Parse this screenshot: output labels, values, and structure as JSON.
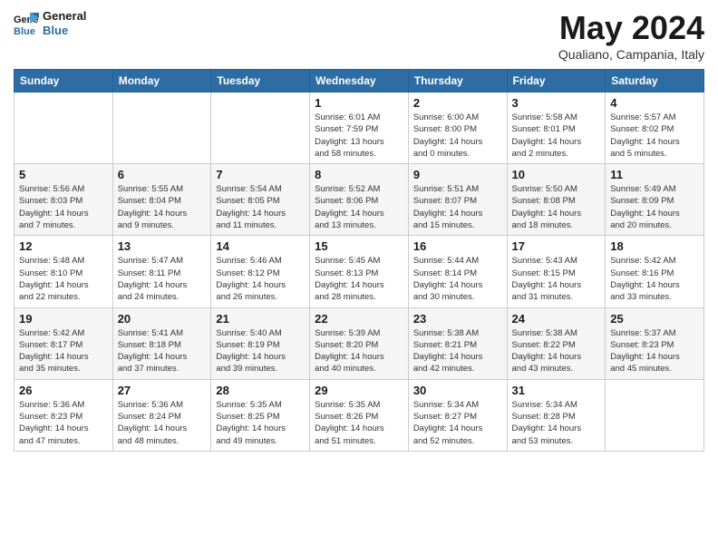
{
  "header": {
    "logo_line1": "General",
    "logo_line2": "Blue",
    "month_title": "May 2024",
    "subtitle": "Qualiano, Campania, Italy"
  },
  "days_of_week": [
    "Sunday",
    "Monday",
    "Tuesday",
    "Wednesday",
    "Thursday",
    "Friday",
    "Saturday"
  ],
  "weeks": [
    [
      {
        "num": "",
        "info": ""
      },
      {
        "num": "",
        "info": ""
      },
      {
        "num": "",
        "info": ""
      },
      {
        "num": "1",
        "info": "Sunrise: 6:01 AM\nSunset: 7:59 PM\nDaylight: 13 hours\nand 58 minutes."
      },
      {
        "num": "2",
        "info": "Sunrise: 6:00 AM\nSunset: 8:00 PM\nDaylight: 14 hours\nand 0 minutes."
      },
      {
        "num": "3",
        "info": "Sunrise: 5:58 AM\nSunset: 8:01 PM\nDaylight: 14 hours\nand 2 minutes."
      },
      {
        "num": "4",
        "info": "Sunrise: 5:57 AM\nSunset: 8:02 PM\nDaylight: 14 hours\nand 5 minutes."
      }
    ],
    [
      {
        "num": "5",
        "info": "Sunrise: 5:56 AM\nSunset: 8:03 PM\nDaylight: 14 hours\nand 7 minutes."
      },
      {
        "num": "6",
        "info": "Sunrise: 5:55 AM\nSunset: 8:04 PM\nDaylight: 14 hours\nand 9 minutes."
      },
      {
        "num": "7",
        "info": "Sunrise: 5:54 AM\nSunset: 8:05 PM\nDaylight: 14 hours\nand 11 minutes."
      },
      {
        "num": "8",
        "info": "Sunrise: 5:52 AM\nSunset: 8:06 PM\nDaylight: 14 hours\nand 13 minutes."
      },
      {
        "num": "9",
        "info": "Sunrise: 5:51 AM\nSunset: 8:07 PM\nDaylight: 14 hours\nand 15 minutes."
      },
      {
        "num": "10",
        "info": "Sunrise: 5:50 AM\nSunset: 8:08 PM\nDaylight: 14 hours\nand 18 minutes."
      },
      {
        "num": "11",
        "info": "Sunrise: 5:49 AM\nSunset: 8:09 PM\nDaylight: 14 hours\nand 20 minutes."
      }
    ],
    [
      {
        "num": "12",
        "info": "Sunrise: 5:48 AM\nSunset: 8:10 PM\nDaylight: 14 hours\nand 22 minutes."
      },
      {
        "num": "13",
        "info": "Sunrise: 5:47 AM\nSunset: 8:11 PM\nDaylight: 14 hours\nand 24 minutes."
      },
      {
        "num": "14",
        "info": "Sunrise: 5:46 AM\nSunset: 8:12 PM\nDaylight: 14 hours\nand 26 minutes."
      },
      {
        "num": "15",
        "info": "Sunrise: 5:45 AM\nSunset: 8:13 PM\nDaylight: 14 hours\nand 28 minutes."
      },
      {
        "num": "16",
        "info": "Sunrise: 5:44 AM\nSunset: 8:14 PM\nDaylight: 14 hours\nand 30 minutes."
      },
      {
        "num": "17",
        "info": "Sunrise: 5:43 AM\nSunset: 8:15 PM\nDaylight: 14 hours\nand 31 minutes."
      },
      {
        "num": "18",
        "info": "Sunrise: 5:42 AM\nSunset: 8:16 PM\nDaylight: 14 hours\nand 33 minutes."
      }
    ],
    [
      {
        "num": "19",
        "info": "Sunrise: 5:42 AM\nSunset: 8:17 PM\nDaylight: 14 hours\nand 35 minutes."
      },
      {
        "num": "20",
        "info": "Sunrise: 5:41 AM\nSunset: 8:18 PM\nDaylight: 14 hours\nand 37 minutes."
      },
      {
        "num": "21",
        "info": "Sunrise: 5:40 AM\nSunset: 8:19 PM\nDaylight: 14 hours\nand 39 minutes."
      },
      {
        "num": "22",
        "info": "Sunrise: 5:39 AM\nSunset: 8:20 PM\nDaylight: 14 hours\nand 40 minutes."
      },
      {
        "num": "23",
        "info": "Sunrise: 5:38 AM\nSunset: 8:21 PM\nDaylight: 14 hours\nand 42 minutes."
      },
      {
        "num": "24",
        "info": "Sunrise: 5:38 AM\nSunset: 8:22 PM\nDaylight: 14 hours\nand 43 minutes."
      },
      {
        "num": "25",
        "info": "Sunrise: 5:37 AM\nSunset: 8:23 PM\nDaylight: 14 hours\nand 45 minutes."
      }
    ],
    [
      {
        "num": "26",
        "info": "Sunrise: 5:36 AM\nSunset: 8:23 PM\nDaylight: 14 hours\nand 47 minutes."
      },
      {
        "num": "27",
        "info": "Sunrise: 5:36 AM\nSunset: 8:24 PM\nDaylight: 14 hours\nand 48 minutes."
      },
      {
        "num": "28",
        "info": "Sunrise: 5:35 AM\nSunset: 8:25 PM\nDaylight: 14 hours\nand 49 minutes."
      },
      {
        "num": "29",
        "info": "Sunrise: 5:35 AM\nSunset: 8:26 PM\nDaylight: 14 hours\nand 51 minutes."
      },
      {
        "num": "30",
        "info": "Sunrise: 5:34 AM\nSunset: 8:27 PM\nDaylight: 14 hours\nand 52 minutes."
      },
      {
        "num": "31",
        "info": "Sunrise: 5:34 AM\nSunset: 8:28 PM\nDaylight: 14 hours\nand 53 minutes."
      },
      {
        "num": "",
        "info": ""
      }
    ]
  ]
}
